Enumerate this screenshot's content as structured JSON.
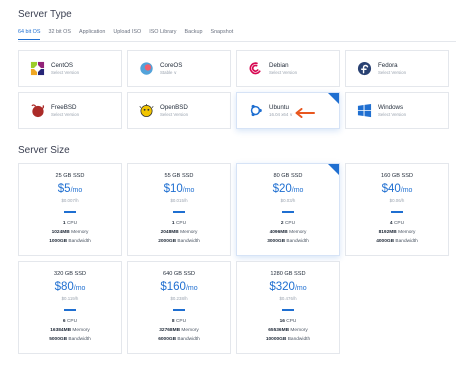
{
  "server_type": {
    "title": "Server Type",
    "tabs": [
      "64 bit OS",
      "32 bit OS",
      "Application",
      "Upload ISO",
      "ISO Library",
      "Backup",
      "Snapshot"
    ],
    "os": [
      {
        "name": "CentOS",
        "sub": "Select Version",
        "icon": "centos-icon"
      },
      {
        "name": "CoreOS",
        "sub": "Stable ∨",
        "icon": "coreos-icon"
      },
      {
        "name": "Debian",
        "sub": "Select Version",
        "icon": "debian-icon"
      },
      {
        "name": "Fedora",
        "sub": "Select Version",
        "icon": "fedora-icon"
      },
      {
        "name": "FreeBSD",
        "sub": "Select Version",
        "icon": "freebsd-icon"
      },
      {
        "name": "OpenBSD",
        "sub": "Select Version",
        "icon": "openbsd-icon"
      },
      {
        "name": "Ubuntu",
        "sub": "16.04 x64 ∨",
        "icon": "ubuntu-icon"
      },
      {
        "name": "Windows",
        "sub": "Select Version",
        "icon": "windows-icon"
      }
    ]
  },
  "server_size": {
    "title": "Server Size",
    "plans": [
      {
        "disk": "25 GB SSD",
        "price": "$5",
        "per": "/mo",
        "hour": "$0.007/h",
        "cpu": "1",
        "mem": "1024MB",
        "bw": "1000GB"
      },
      {
        "disk": "55 GB SSD",
        "price": "$10",
        "per": "/mo",
        "hour": "$0.015/h",
        "cpu": "1",
        "mem": "2048MB",
        "bw": "2000GB"
      },
      {
        "disk": "80 GB SSD",
        "price": "$20",
        "per": "/mo",
        "hour": "$0.03/h",
        "cpu": "2",
        "mem": "4096MB",
        "bw": "3000GB"
      },
      {
        "disk": "160 GB SSD",
        "price": "$40",
        "per": "/mo",
        "hour": "$0.06/h",
        "cpu": "4",
        "mem": "8192MB",
        "bw": "4000GB"
      },
      {
        "disk": "320 GB SSD",
        "price": "$80",
        "per": "/mo",
        "hour": "$0.119/h",
        "cpu": "6",
        "mem": "16384MB",
        "bw": "5000GB"
      },
      {
        "disk": "640 GB SSD",
        "price": "$160",
        "per": "/mo",
        "hour": "$0.238/h",
        "cpu": "8",
        "mem": "32768MB",
        "bw": "6000GB"
      },
      {
        "disk": "1280 GB SSD",
        "price": "$320",
        "per": "/mo",
        "hour": "$0.476/h",
        "cpu": "16",
        "mem": "65536MB",
        "bw": "10000GB"
      }
    ],
    "labels": {
      "cpu": "CPU",
      "memory": "Memory",
      "bandwidth": "Bandwidth"
    }
  },
  "colors": {
    "accent": "#1f6fd1",
    "arrow": "#e8571f"
  }
}
